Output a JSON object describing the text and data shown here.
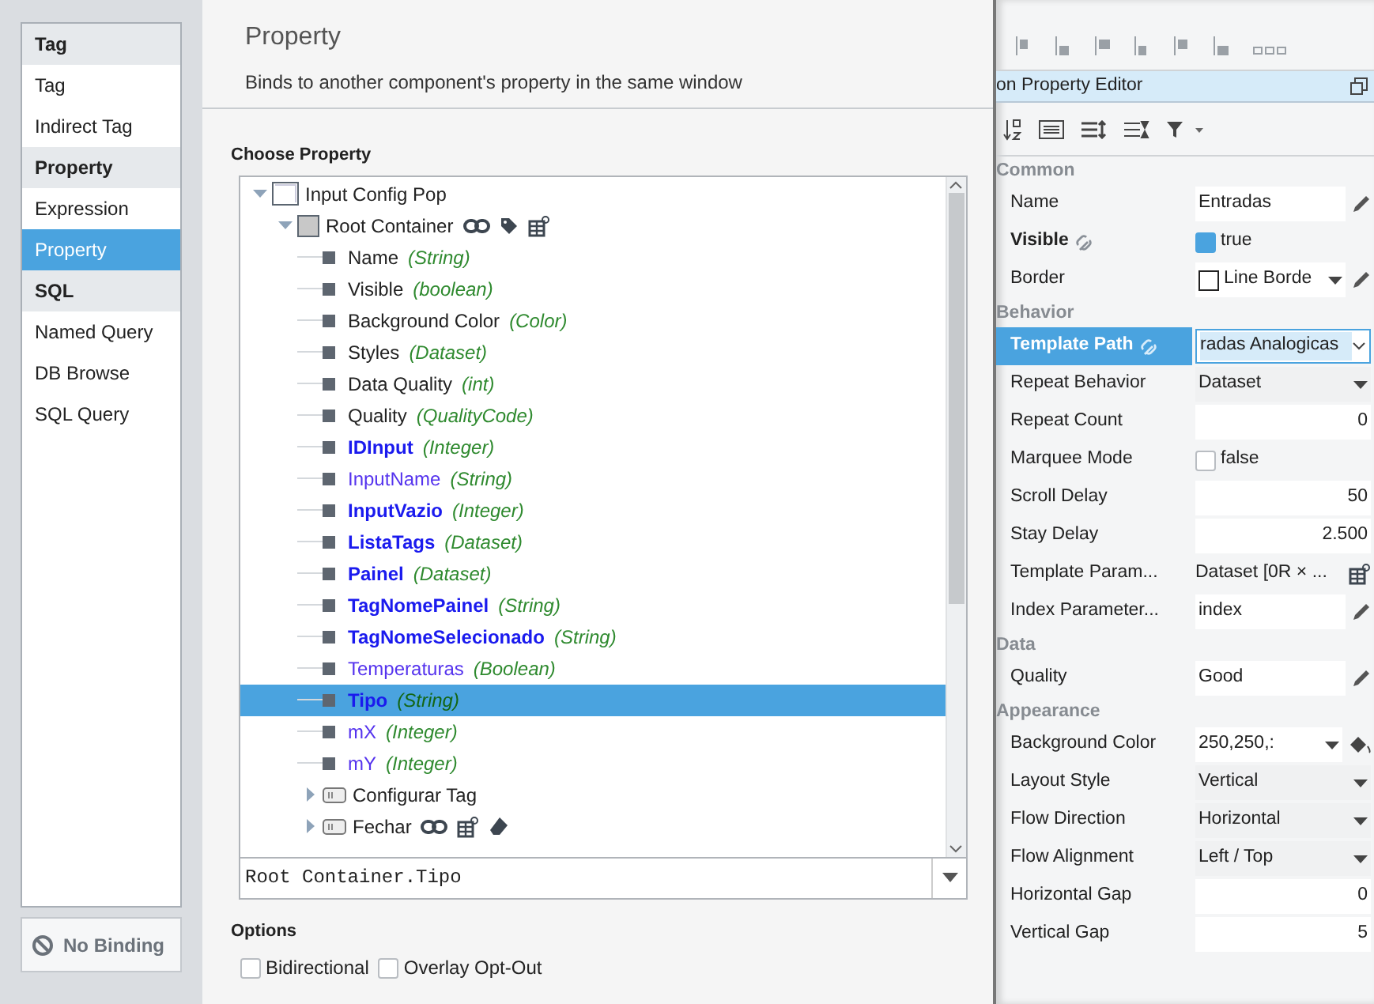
{
  "binding_types": [
    {
      "kind": "header",
      "label": "Tag"
    },
    {
      "kind": "item",
      "label": "Tag",
      "selected": false
    },
    {
      "kind": "item",
      "label": "Indirect Tag",
      "selected": false
    },
    {
      "kind": "header",
      "label": "Property"
    },
    {
      "kind": "item",
      "label": "Expression",
      "selected": false
    },
    {
      "kind": "item",
      "label": "Property",
      "selected": true
    },
    {
      "kind": "header",
      "label": "SQL"
    },
    {
      "kind": "item",
      "label": "Named Query",
      "selected": false
    },
    {
      "kind": "item",
      "label": "DB Browse",
      "selected": false
    },
    {
      "kind": "item",
      "label": "SQL Query",
      "selected": false
    }
  ],
  "no_binding_button": "No Binding",
  "dialog": {
    "title": "Property",
    "subtitle": "Binds to another component's property in the same window",
    "choose_label": "Choose Property",
    "tree": [
      {
        "kind": "window",
        "label": "Input Config Pop",
        "expanded": true,
        "selected": false,
        "children": [
          {
            "kind": "container",
            "label": "Root Container",
            "expanded": true,
            "selected": false,
            "badges": [
              {
                "kind": "link"
              },
              {
                "kind": "tag"
              },
              {
                "kind": "table"
              }
            ],
            "children": [
              {
                "kind": "property",
                "label": "Name",
                "type": "(String)",
                "custom": false,
                "bold": false,
                "selected": false
              },
              {
                "kind": "property",
                "label": "Visible",
                "type": "(boolean)",
                "custom": false,
                "bold": false,
                "selected": false
              },
              {
                "kind": "property",
                "label": "Background Color",
                "type": "(Color)",
                "custom": false,
                "bold": false,
                "selected": false
              },
              {
                "kind": "property",
                "label": "Styles",
                "type": "(Dataset)",
                "custom": false,
                "bold": false,
                "selected": false
              },
              {
                "kind": "property",
                "label": "Data Quality",
                "type": "(int)",
                "custom": false,
                "bold": false,
                "selected": false
              },
              {
                "kind": "property",
                "label": "Quality",
                "type": "(QualityCode)",
                "custom": false,
                "bold": false,
                "selected": false
              },
              {
                "kind": "property",
                "label": "IDInput",
                "type": "(Integer)",
                "custom": true,
                "bold": true,
                "selected": false
              },
              {
                "kind": "property",
                "label": "InputName",
                "type": "(String)",
                "custom": true,
                "bold": false,
                "selected": false
              },
              {
                "kind": "property",
                "label": "InputVazio",
                "type": "(Integer)",
                "custom": true,
                "bold": true,
                "selected": false
              },
              {
                "kind": "property",
                "label": "ListaTags",
                "type": "(Dataset)",
                "custom": true,
                "bold": true,
                "selected": false
              },
              {
                "kind": "property",
                "label": "Painel",
                "type": "(Dataset)",
                "custom": true,
                "bold": true,
                "selected": false
              },
              {
                "kind": "property",
                "label": "TagNomePainel",
                "type": "(String)",
                "custom": true,
                "bold": true,
                "selected": false
              },
              {
                "kind": "property",
                "label": "TagNomeSelecionado",
                "type": "(String)",
                "custom": true,
                "bold": true,
                "selected": false
              },
              {
                "kind": "property",
                "label": "Temperaturas",
                "type": "(Boolean)",
                "custom": true,
                "bold": false,
                "selected": false
              },
              {
                "kind": "property",
                "label": "Tipo",
                "type": "(String)",
                "custom": true,
                "bold": true,
                "selected": true
              },
              {
                "kind": "property",
                "label": "mX",
                "type": "(Integer)",
                "custom": true,
                "bold": false,
                "selected": false
              },
              {
                "kind": "property",
                "label": "mY",
                "type": "(Integer)",
                "custom": true,
                "bold": false,
                "selected": false
              },
              {
                "kind": "button",
                "label": "Configurar Tag",
                "expanded": false,
                "selected": false
              },
              {
                "kind": "button",
                "label": "Fechar",
                "expanded": false,
                "selected": false,
                "badges": [
                  {
                    "kind": "link"
                  },
                  {
                    "kind": "table"
                  },
                  {
                    "kind": "eraser"
                  }
                ]
              }
            ]
          }
        ]
      }
    ],
    "path_value": "Root Container.Tipo",
    "options_label": "Options",
    "options": [
      {
        "label": "Bidirectional",
        "checked": false
      },
      {
        "label": "Overlay Opt-Out",
        "checked": false
      }
    ]
  },
  "property_editor": {
    "title": "on Property Editor",
    "sections": [
      {
        "title": "Common",
        "rows": [
          {
            "name": "Name",
            "kind": "text",
            "value": "Entradas",
            "action": {
              "kind": "pencil"
            },
            "bold": false,
            "linked": false,
            "selected": false
          },
          {
            "name": "Visible",
            "kind": "check",
            "value": "true",
            "checked": true,
            "bold": true,
            "linked": true,
            "selected": false
          },
          {
            "name": "Border",
            "kind": "swatch",
            "value": "Line Borde",
            "action": {
              "kind": "pencil"
            },
            "bold": false,
            "linked": false,
            "selected": false
          }
        ]
      },
      {
        "title": "Behavior",
        "rows": [
          {
            "name": "Template Path",
            "kind": "combo",
            "value": "radas Analogicas",
            "bold": false,
            "linked": true,
            "selected": true
          },
          {
            "name": "Repeat Behavior",
            "kind": "dropdown",
            "value": "Dataset",
            "bold": false,
            "linked": false,
            "selected": false
          },
          {
            "name": "Repeat Count",
            "kind": "number",
            "value": "0",
            "bold": false,
            "linked": false,
            "selected": false
          },
          {
            "name": "Marquee Mode",
            "kind": "check",
            "value": "false",
            "checked": false,
            "bold": false,
            "linked": false,
            "selected": false
          },
          {
            "name": "Scroll Delay",
            "kind": "number",
            "value": "50",
            "bold": false,
            "linked": false,
            "selected": false
          },
          {
            "name": "Stay Delay",
            "kind": "number",
            "value": "2.500",
            "bold": false,
            "linked": false,
            "selected": false
          },
          {
            "name": "Template Param...",
            "kind": "plain",
            "value": "Dataset [0R × ...",
            "action": {
              "kind": "table"
            },
            "bold": false,
            "linked": false,
            "selected": false
          },
          {
            "name": "Index Parameter...",
            "kind": "text",
            "value": "index",
            "action": {
              "kind": "pencil"
            },
            "bold": false,
            "linked": false,
            "selected": false
          }
        ]
      },
      {
        "title": "Data",
        "rows": [
          {
            "name": "Quality",
            "kind": "text",
            "value": "Good",
            "action": {
              "kind": "pencil"
            },
            "bold": false,
            "linked": false,
            "selected": false
          }
        ]
      },
      {
        "title": "Appearance",
        "rows": [
          {
            "name": "Background Color",
            "kind": "color",
            "value": "250,250,:",
            "action": {
              "kind": "bucket"
            },
            "bold": false,
            "linked": false,
            "selected": false
          },
          {
            "name": "Layout Style",
            "kind": "dropdown",
            "value": "Vertical",
            "bold": false,
            "linked": false,
            "selected": false
          },
          {
            "name": "Flow Direction",
            "kind": "dropdown",
            "value": "Horizontal",
            "bold": false,
            "linked": false,
            "selected": false
          },
          {
            "name": "Flow Alignment",
            "kind": "dropdown",
            "value": "Left / Top",
            "bold": false,
            "linked": false,
            "selected": false
          },
          {
            "name": "Horizontal Gap",
            "kind": "number",
            "value": "0",
            "bold": false,
            "linked": false,
            "selected": false
          },
          {
            "name": "Vertical Gap",
            "kind": "number",
            "value": "5",
            "bold": false,
            "linked": false,
            "selected": false
          }
        ]
      }
    ]
  }
}
